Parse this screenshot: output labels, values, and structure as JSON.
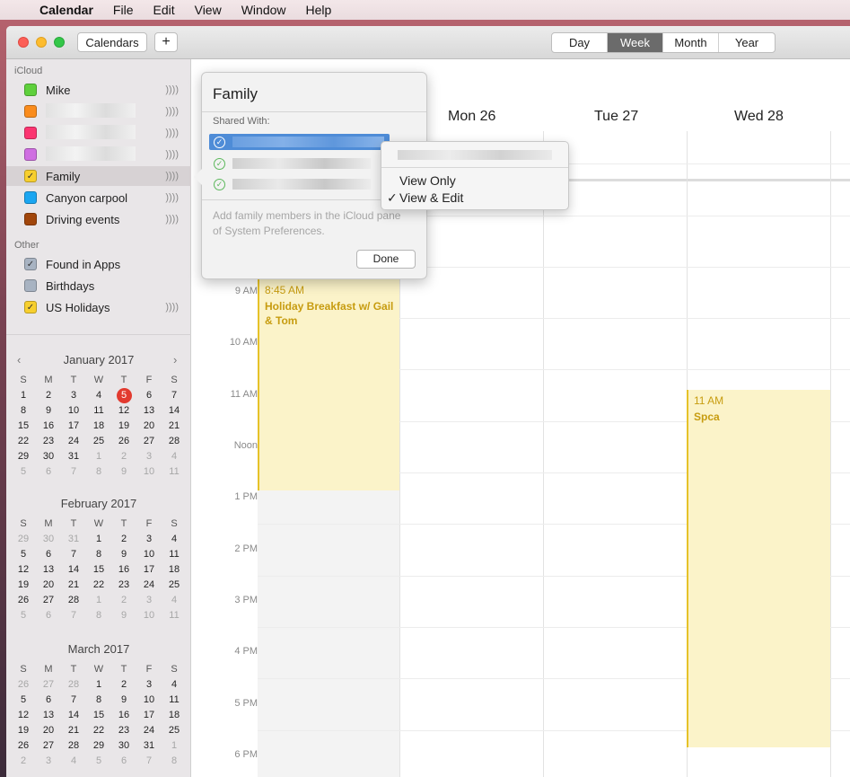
{
  "menubar": {
    "app": "Calendar",
    "items": [
      "File",
      "Edit",
      "View",
      "Window",
      "Help"
    ]
  },
  "toolbar": {
    "calendars_label": "Calendars",
    "add_label": "+",
    "views": [
      "Day",
      "Week",
      "Month",
      "Year"
    ],
    "active_view": "Week"
  },
  "sidebar": {
    "icloud_header": "iCloud",
    "icloud_calendars": [
      {
        "name": "Mike",
        "color": "#5fd03c",
        "checked": false
      },
      {
        "name": "",
        "color": "#fa8c1c",
        "checked": false
      },
      {
        "name": "",
        "color": "#fb3470",
        "checked": false
      },
      {
        "name": "",
        "color": "#cf6ee1",
        "checked": false
      },
      {
        "name": "Family",
        "color": "#f7cf2e",
        "checked": true
      },
      {
        "name": "Canyon carpool",
        "color": "#1ba6f1",
        "checked": false
      },
      {
        "name": "Driving events",
        "color": "#a1460b",
        "checked": false
      }
    ],
    "other_header": "Other",
    "other_calendars": [
      {
        "name": "Found in Apps",
        "color": "#a8b3c2",
        "checked": true
      },
      {
        "name": "Birthdays",
        "color": "#a8b3c2",
        "checked": false
      },
      {
        "name": "US Holidays",
        "color": "#f7cf2e",
        "checked": true
      }
    ]
  },
  "mini_calendars": [
    {
      "title": "January 2017",
      "weekdays": [
        "S",
        "M",
        "T",
        "W",
        "T",
        "F",
        "S"
      ],
      "days": [
        "1",
        "2",
        "3",
        "4",
        "5",
        "6",
        "7",
        "8",
        "9",
        "10",
        "11",
        "12",
        "13",
        "14",
        "15",
        "16",
        "17",
        "18",
        "19",
        "20",
        "21",
        "22",
        "23",
        "24",
        "25",
        "26",
        "27",
        "28",
        "29",
        "30",
        "31",
        "1",
        "2",
        "3",
        "4",
        "5",
        "6",
        "7",
        "8",
        "9",
        "10",
        "11"
      ],
      "dim_from": 31,
      "today_index": 4
    },
    {
      "title": "February 2017",
      "weekdays": [
        "S",
        "M",
        "T",
        "W",
        "T",
        "F",
        "S"
      ],
      "days": [
        "29",
        "30",
        "31",
        "1",
        "2",
        "3",
        "4",
        "5",
        "6",
        "7",
        "8",
        "9",
        "10",
        "11",
        "12",
        "13",
        "14",
        "15",
        "16",
        "17",
        "18",
        "19",
        "20",
        "21",
        "22",
        "23",
        "24",
        "25",
        "26",
        "27",
        "28",
        "1",
        "2",
        "3",
        "4",
        "5",
        "6",
        "7",
        "8",
        "9",
        "10",
        "11"
      ],
      "dim_before": 3,
      "dim_from": 31
    },
    {
      "title": "March 2017",
      "weekdays": [
        "S",
        "M",
        "T",
        "W",
        "T",
        "F",
        "S"
      ],
      "days": [
        "26",
        "27",
        "28",
        "1",
        "2",
        "3",
        "4",
        "5",
        "6",
        "7",
        "8",
        "9",
        "10",
        "11",
        "12",
        "13",
        "14",
        "15",
        "16",
        "17",
        "18",
        "19",
        "20",
        "21",
        "22",
        "23",
        "24",
        "25",
        "26",
        "27",
        "28",
        "29",
        "30",
        "31",
        "1",
        "2",
        "3",
        "4",
        "5",
        "6",
        "7",
        "8"
      ],
      "dim_before": 3,
      "dim_from": 34
    }
  ],
  "week": {
    "day_headers": [
      "Mon 26",
      "Tue 27",
      "Wed 28"
    ],
    "time_labels": [
      "9 AM",
      "10 AM",
      "11 AM",
      "Noon",
      "1 PM",
      "2 PM",
      "3 PM",
      "4 PM",
      "5 PM",
      "6 PM"
    ]
  },
  "events": [
    {
      "time": "8:45 AM",
      "title": "Holiday Breakfast w/ Gail & Tom"
    },
    {
      "time": "11 AM",
      "title": "Spca"
    }
  ],
  "popover": {
    "title": "Family",
    "shared_with_label": "Shared With:",
    "hint": "Add family members in the iCloud pane of System Preferences.",
    "done_label": "Done"
  },
  "context_menu": {
    "items": [
      "View Only",
      "View & Edit"
    ],
    "checked_item": "View & Edit",
    "check_glyph": "✓"
  }
}
